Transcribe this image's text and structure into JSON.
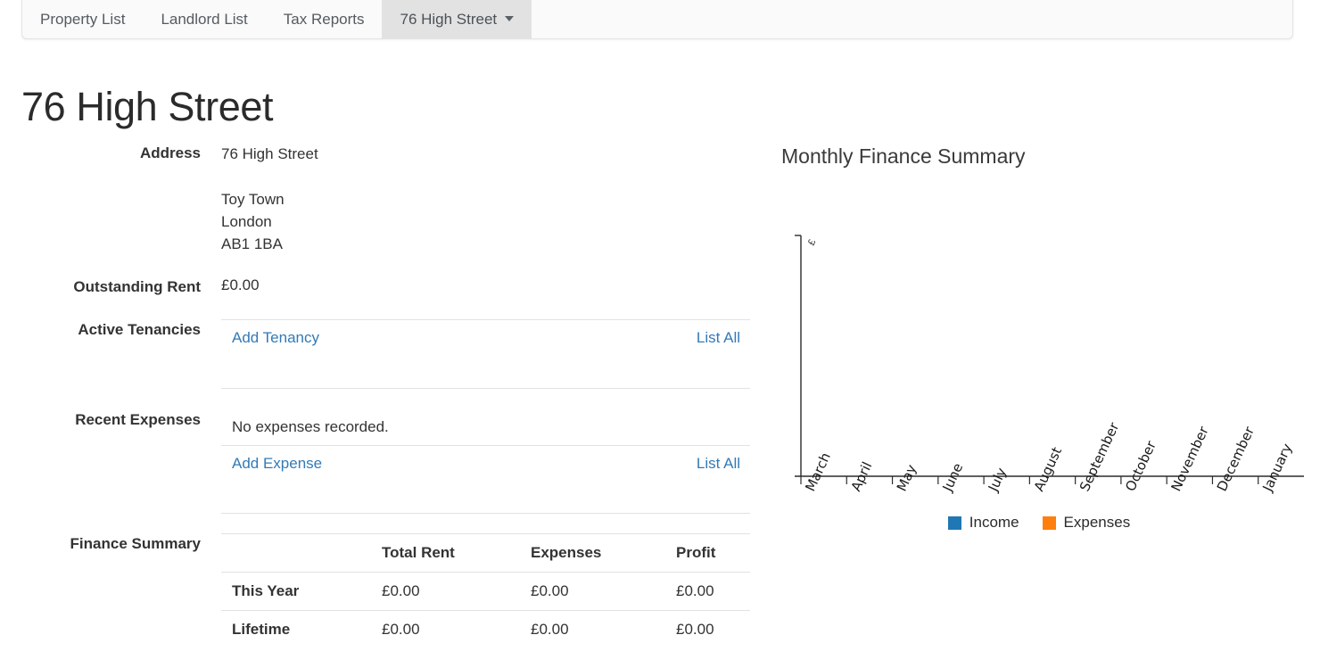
{
  "tabs": [
    {
      "label": "Property List",
      "active": false,
      "caret": false
    },
    {
      "label": "Landlord List",
      "active": false,
      "caret": false
    },
    {
      "label": "Tax Reports",
      "active": false,
      "caret": false
    },
    {
      "label": "76 High Street",
      "active": true,
      "caret": true
    }
  ],
  "page": {
    "title": "76 High Street"
  },
  "details": {
    "address_label": "Address",
    "address_line1": "76 High Street",
    "address_town": "Toy Town",
    "address_city": "London",
    "address_postcode": "AB1 1BA",
    "outstanding_rent_label": "Outstanding Rent",
    "outstanding_rent_value": "£0.00",
    "active_tenancies_label": "Active Tenancies",
    "add_tenancy_link": "Add Tenancy",
    "tenancy_list_all_link": "List All",
    "recent_expenses_label": "Recent Expenses",
    "no_expenses_text": "No expenses recorded.",
    "add_expense_link": "Add Expense",
    "expense_list_all_link": "List All",
    "finance_summary_label": "Finance Summary"
  },
  "finance_table": {
    "headers": [
      "",
      "Total Rent",
      "Expenses",
      "Profit"
    ],
    "rows": [
      {
        "name": "This Year",
        "total_rent": "£0.00",
        "expenses": "£0.00",
        "profit": "£0.00"
      },
      {
        "name": "Lifetime",
        "total_rent": "£0.00",
        "expenses": "£0.00",
        "profit": "£0.00"
      }
    ]
  },
  "chart_data": {
    "type": "bar",
    "title": "Monthly Finance Summary",
    "xlabel": "",
    "ylabel": "£",
    "categories": [
      "March",
      "April",
      "May",
      "June",
      "July",
      "August",
      "September",
      "October",
      "November",
      "December",
      "January"
    ],
    "series": [
      {
        "name": "Income",
        "color": "#1f77b4",
        "values": [
          0,
          0,
          0,
          0,
          0,
          0,
          0,
          0,
          0,
          0,
          0
        ]
      },
      {
        "name": "Expenses",
        "color": "#ff7f0e",
        "values": [
          0,
          0,
          0,
          0,
          0,
          0,
          0,
          0,
          0,
          0,
          0
        ]
      }
    ],
    "ylim": [
      0,
      1
    ],
    "ytick_labels": [],
    "grid": false,
    "legend_position": "bottom",
    "xtick_rotation": -65
  },
  "colors": {
    "income": "#1f77b4",
    "expenses": "#ff7f0e",
    "link": "#337ab7",
    "active_tab_bg": "#e2e2e2"
  }
}
